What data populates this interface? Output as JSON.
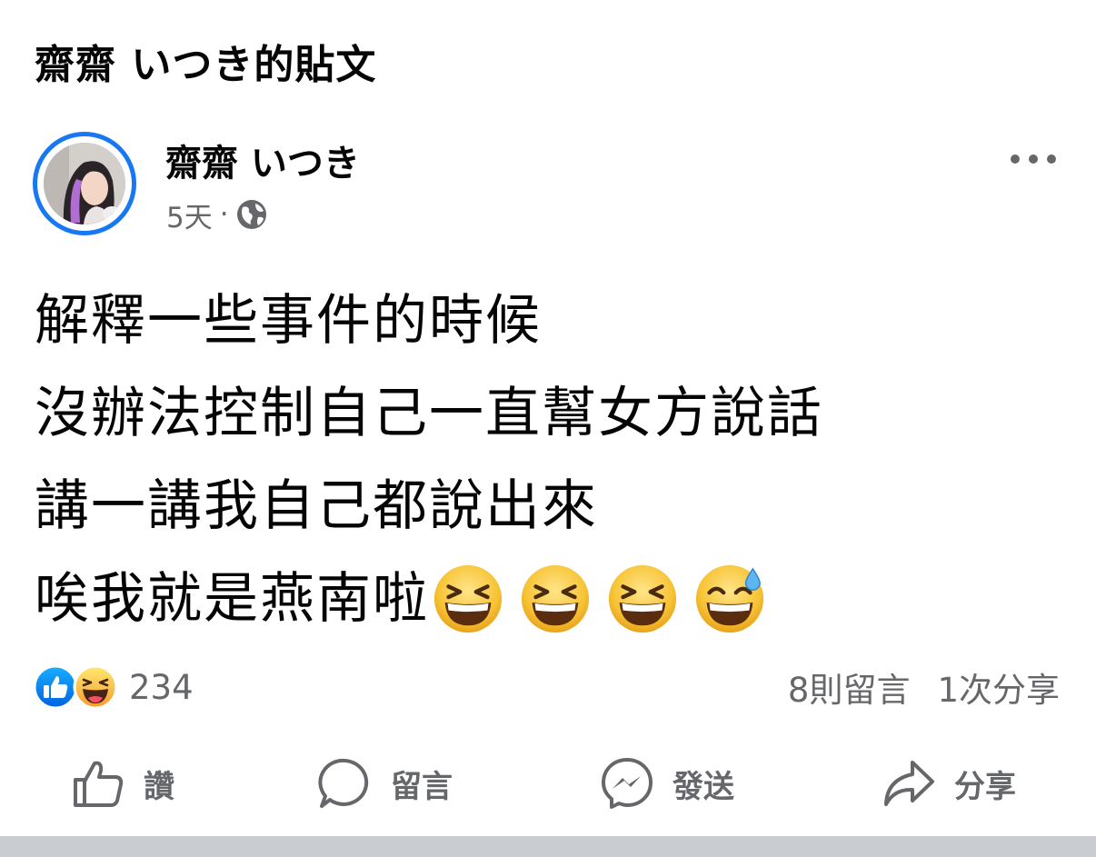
{
  "page": {
    "title": "齋齋 いつき的貼文"
  },
  "post": {
    "author": "齋齋 いつき",
    "time": "5天",
    "separator": "·",
    "privacy_icon": "globe-icon",
    "lines": [
      "解釋一些事件的時候",
      "沒辦法控制自己一直幫女方說話",
      "講一講我自己都說出來",
      "唉我就是燕南啦"
    ],
    "line4_emojis": [
      "grinning-squinting-face",
      "grinning-squinting-face",
      "grinning-squinting-face",
      "grinning-face-with-sweat"
    ]
  },
  "reactions": {
    "icons": [
      "like-icon",
      "haha-icon"
    ],
    "count": "234"
  },
  "stats": {
    "comments": "8則留言",
    "shares": "1次分享"
  },
  "actions": [
    {
      "label": "讚",
      "icon": "thumbs-up-icon"
    },
    {
      "label": "留言",
      "icon": "comment-icon"
    },
    {
      "label": "發送",
      "icon": "messenger-icon"
    },
    {
      "label": "分享",
      "icon": "share-icon"
    }
  ],
  "colors": {
    "accent": "#1877f2",
    "secondary_text": "#65676b",
    "text": "#050505",
    "emoji_yellow": "#f7c436"
  }
}
